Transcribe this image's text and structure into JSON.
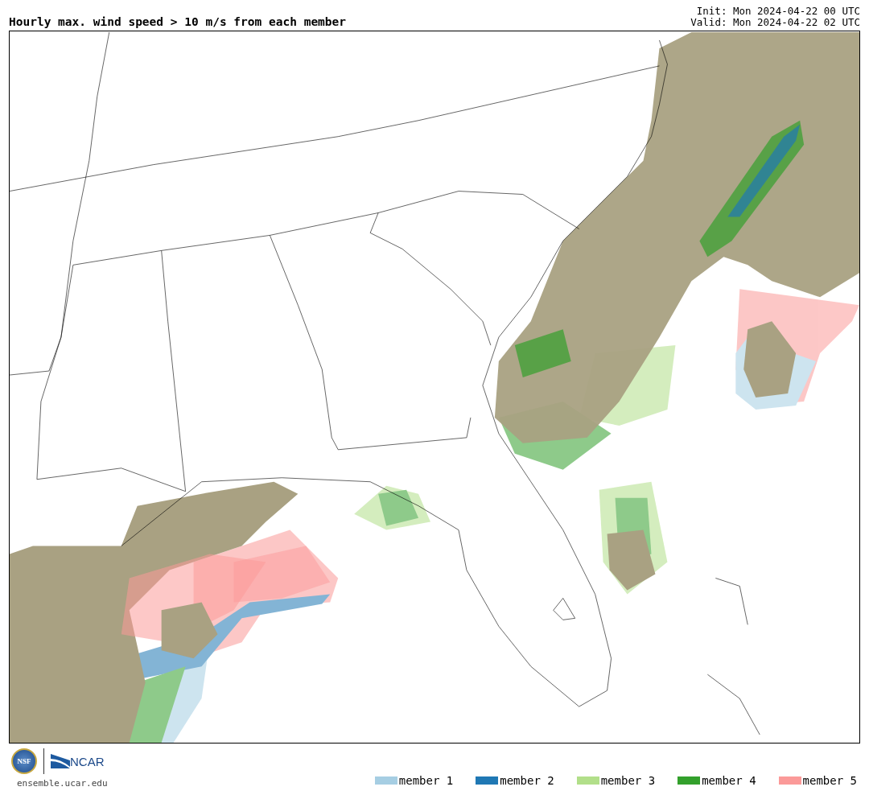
{
  "title": "Hourly max. wind speed > 10 m/s from each member",
  "init": "Init: Mon 2024-04-22 00 UTC",
  "valid": "Valid: Mon 2024-04-22 02 UTC",
  "logos": {
    "nsf": "NSF",
    "ncar": "NCAR"
  },
  "website": "ensemble.ucar.edu",
  "legend": [
    {
      "label": "member 1",
      "color": "#a6cee3"
    },
    {
      "label": "member 2",
      "color": "#1f78b4"
    },
    {
      "label": "member 3",
      "color": "#b2df8a"
    },
    {
      "label": "member 4",
      "color": "#33a02c"
    },
    {
      "label": "member 5",
      "color": "#fb9a99"
    }
  ]
}
